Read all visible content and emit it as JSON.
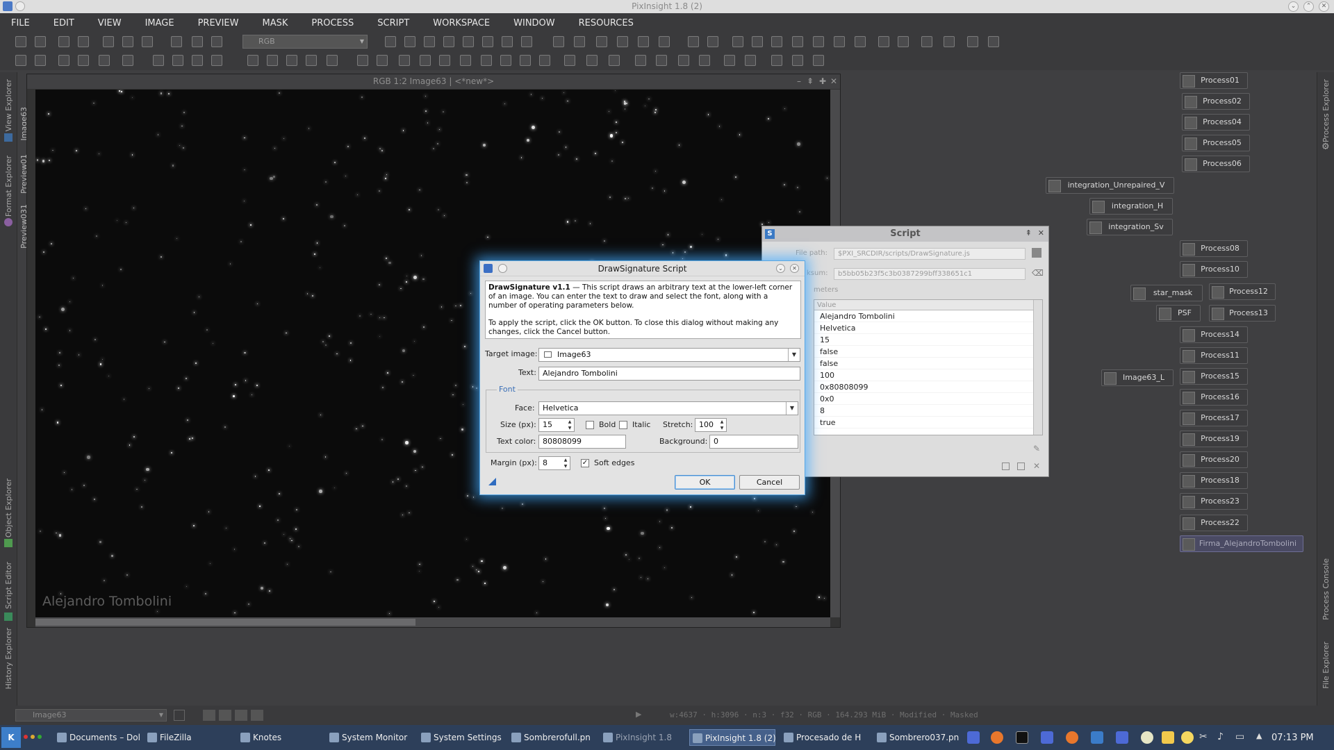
{
  "app": {
    "title": "PixInsight 1.8 (2)"
  },
  "menu": [
    "FILE",
    "EDIT",
    "VIEW",
    "IMAGE",
    "PREVIEW",
    "MASK",
    "PROCESS",
    "SCRIPT",
    "WORKSPACE",
    "WINDOW",
    "RESOURCES"
  ],
  "toolbar": {
    "color_space_value": "RGB"
  },
  "left_tabs": [
    "View Explorer",
    "Image63",
    "Preview01",
    "Format Explorer",
    "Preview031",
    "Object Explorer",
    "Script Editor",
    "History Explorer"
  ],
  "right_tabs": [
    "Process Explorer",
    "Process Console",
    "File Explorer"
  ],
  "image_window": {
    "title": "RGB 1:2 Image63 | <*new*>",
    "signature_overlay": "Alejandro Tombolini"
  },
  "process_icons": {
    "p01": "Process01",
    "p02": "Process02",
    "p04": "Process04",
    "p05": "Process05",
    "p06": "Process06",
    "int_unrep": "integration_Unrepaired_V",
    "int_h": "integration_H",
    "int_sv": "integration_Sv",
    "p08": "Process08",
    "p10": "Process10",
    "star_mask": "star_mask",
    "p12": "Process12",
    "psf": "PSF",
    "p13": "Process13",
    "p14": "Process14",
    "p11": "Process11",
    "p15": "Process15",
    "img63l": "Image63_L",
    "p16": "Process16",
    "p17": "Process17",
    "p19": "Process19",
    "p20": "Process20",
    "p18": "Process18",
    "p23": "Process23",
    "p22": "Process22",
    "firma": "Firma_AlejandroTombolini"
  },
  "script_window": {
    "title": "Script",
    "file_path_label": "File path:",
    "file_path": "$PXI_SRCDIR/scripts/DrawSignature.js",
    "checksum_label": "ksum:",
    "checksum": "b5bb05b23f5c3b0387299bff338651c1",
    "parameters_label": "meters",
    "value_header": "Value",
    "values": [
      "Alejandro Tombolini",
      "Helvetica",
      "15",
      "false",
      "false",
      "100",
      "0x80808099",
      "0x0",
      "8",
      "true"
    ]
  },
  "dialog": {
    "title": "DrawSignature Script",
    "desc_bold": "DrawSignature v1.1",
    "desc_text": " — This script draws an arbitrary text at the lower-left corner of an image. You can enter the text to draw and select the font, along with a number of operating parameters below.",
    "desc_text2": "To apply the script, click the OK button. To close this dialog without making any changes, click the Cancel button.",
    "target_label": "Target image:",
    "target_value": "Image63",
    "text_label": "Text:",
    "text_value": "Alejandro Tombolini",
    "font_group": "Font",
    "face_label": "Face:",
    "face_value": "Helvetica",
    "size_label": "Size (px):",
    "size_value": "15",
    "bold_label": "Bold",
    "italic_label": "Italic",
    "stretch_label": "Stretch:",
    "stretch_value": "100",
    "textcolor_label": "Text color:",
    "textcolor_value": "80808099",
    "background_label": "Background:",
    "background_value": "0",
    "margin_label": "Margin (px):",
    "margin_value": "8",
    "soft_edges_label": "Soft edges",
    "ok_label": "OK",
    "cancel_label": "Cancel"
  },
  "statusbar": {
    "view_selector": "Image63",
    "info": "w:4637 · h:3096 · n:3 · f32 · RGB · 164.293 MiB · Modified · Masked"
  },
  "taskbar": {
    "items": [
      "Documents – Dol",
      "FileZilla",
      "Knotes",
      "System Monitor",
      "System Settings",
      "Sombrerofull.pn",
      "PixInsight 1.8",
      "PixInsight 1.8 (2)",
      "Procesado de H",
      "Sombrero037.pn"
    ],
    "clock": "07:13 PM"
  }
}
